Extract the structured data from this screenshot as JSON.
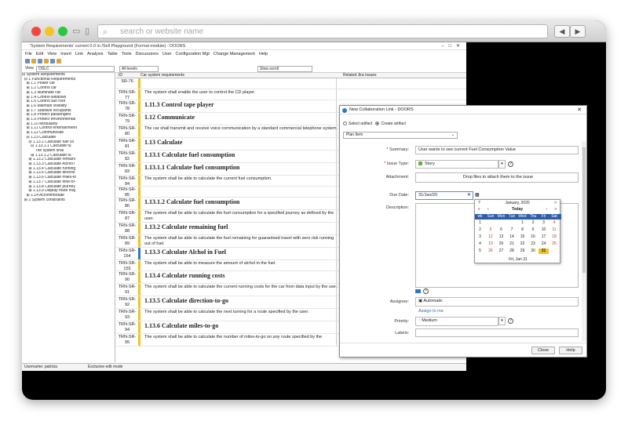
{
  "browser": {
    "address_placeholder": "search or website name",
    "back": "◀",
    "forward": "▶"
  },
  "doors": {
    "title": "'System Requirements' current 0.0 in /Sell Playground (Formal module) - DOORS",
    "menu": [
      "File",
      "Edit",
      "View",
      "Insert",
      "Link",
      "Analysis",
      "Table",
      "Tools",
      "Discussions",
      "User",
      "Configuration Mgt",
      "Change Management",
      "Help"
    ],
    "view_label": "View",
    "view_value": "OSLC",
    "levels_value": "All levels",
    "scroll_value": "Slow scroll",
    "tree": [
      "⊟ System Requirements",
      "  ⊟ 1 Functional Requirements",
      "    ⊞ 1.1 Power car",
      "    ⊞ 1.2 Control car",
      "    ⊞ 1.3 Illuminate car",
      "    ⊞ 1.4 Control windows",
      "    ⊞ 1.5 Control sun roof",
      "    ⊞ 1.6 Maintain visibility",
      "    ⊞ 1.7 Stabilize occupants",
      "    ⊞ 1.8 Protect passengers",
      "    ⊞ 1.9 Protect environmental",
      "    ⊞ 1.10 Modularity",
      "    ⊞ 1.11 Control entertainment",
      "    ⊞ 1.12 Communicate",
      "    ⊟ 1.13 Calculate",
      "      ⊟ 1.13.1 Calculate fuel co",
      "        ⊟ 1.13.1.1 Calculate fu",
      "            The system shal",
      "        ⊞ 1.13.1.2 Calculate fu",
      "      ⊞ 1.13.2 Calculate remaini",
      "      ⊞ 1.13.3 Calculate Alchol i",
      "      ⊞ 1.13.4 Calculate running",
      "      ⊞ 1.13.5 Calculate directio",
      "      ⊞ 1.13.6 Calculate miles-to",
      "      ⊞ 1.13.7 Calculate time-to-",
      "      ⊞ 1.13.8 Calculate journey",
      "      ⊞ 1.13.9 Display route maj",
      "    ⊞ 1.14 Accommodate",
      "  ⊞ 2 System constraints"
    ],
    "columns": {
      "id": "ID",
      "req": "Car system requirements",
      "jira": "Related Jira Issues"
    },
    "rows": [
      {
        "id": "SR-76",
        "kind": "b",
        "text": "",
        "blue": false
      },
      {
        "id": "TRN-SR-77",
        "kind": "b",
        "text": "The system shall enable the user to control the CD player.",
        "blue": false
      },
      {
        "id": "TRN-SR-78",
        "kind": "h",
        "text": "1.11.3 Control tape player",
        "blue": false
      },
      {
        "id": "TRN-SR-79",
        "kind": "h",
        "text": "1.12 Communicate",
        "blue": false
      },
      {
        "id": "TRN-SR-80",
        "kind": "b",
        "text": "The car shall transmit and receive voice communication by a standard commercial telephone system.",
        "blue": false
      },
      {
        "id": "TRN-SR-81",
        "kind": "h",
        "text": "1.13 Calculate",
        "blue": false
      },
      {
        "id": "TRN-SR-82",
        "kind": "h",
        "text": "1.13.1 Calculate fuel consumption",
        "blue": false
      },
      {
        "id": "TRN-SR-83",
        "kind": "h",
        "text": "1.13.1.1 Calculate fuel consumption",
        "blue": false
      },
      {
        "id": "TRN-SR-84",
        "kind": "b",
        "text": "The system shall be able to calculate the current fuel consumption.",
        "blue": false
      },
      {
        "id": "TRN-SR-85",
        "kind": "b",
        "text": "",
        "blue": false
      },
      {
        "id": "TRN-SR-86",
        "kind": "h",
        "text": "1.13.1.2 Calculate fuel consumption",
        "blue": false
      },
      {
        "id": "TRN-SR-87",
        "kind": "b",
        "text": "The system shall be able to calculate the fuel consumption for a specified  journey as defined by the user.",
        "blue": false
      },
      {
        "id": "TRN-SR-88",
        "kind": "h",
        "text": "1.13.2 Calculate remaining fuel",
        "blue": false
      },
      {
        "id": "TRN-SR-89",
        "kind": "b",
        "text": "The system shall be able to calculate the fuel remaining for guaranteed travel with zero risk running out of fuel.",
        "blue": false
      },
      {
        "id": "TRN-SR-154",
        "kind": "h",
        "text": "1.13.3 Calculate Alchol in Fuel",
        "blue": true
      },
      {
        "id": "TRN-SR-155",
        "kind": "b",
        "text": "The system shall be able to measure the amount of alchol in the fuel.",
        "blue": false
      },
      {
        "id": "TRN-SR-90",
        "kind": "h",
        "text": "1.13.4 Calculate running costs",
        "blue": false
      },
      {
        "id": "TRN-SR-91",
        "kind": "b",
        "text": "The system shall be able to calculate the current running costs for the car from data input by the user.",
        "blue": false
      },
      {
        "id": "TRN-SR-92",
        "kind": "h",
        "text": "1.13.5 Calculate direction-to-go",
        "blue": false
      },
      {
        "id": "TRN-SR-93",
        "kind": "b",
        "text": "The system shall be able to calculate the next turning for a route specified by the user.",
        "blue": false
      },
      {
        "id": "TRN-SR-94",
        "kind": "h",
        "text": "1.13.6 Calculate miles-to-go",
        "blue": false
      },
      {
        "id": "TRN-SR-95",
        "kind": "b",
        "text": "The system shall be able to calculate the number of miles-to-go on any route specified by the",
        "blue": false
      }
    ],
    "status_user": "Username: patricia",
    "status_mode": "Exclusive edit mode"
  },
  "dialog": {
    "title": "New Collaboration Link - DOORS",
    "close": "✕",
    "select_artifact": "Select artifact",
    "create_artifact": "Create artifact",
    "plan_item": "Plan Item",
    "summary_label": "Summary:",
    "summary_value": "User wants to see current Fuel Consumption Value",
    "issue_type_label": "Issue Type:",
    "issue_type_value": "Story",
    "attachment_label": "Attachment:",
    "attachment_hint": "Drop files to attach them to the issue",
    "due_date_label": "Due Date:",
    "due_date_value": "31/Jan/20",
    "description_label": "Description:",
    "calendar": {
      "month": "January, 2020",
      "today": "Today",
      "nav_prev_year": "«",
      "nav_prev": "‹",
      "nav_next": "›",
      "nav_next_year": "»",
      "nav_q": "?",
      "nav_x": "×",
      "days": [
        "wk",
        "Sun",
        "Mon",
        "Tue",
        "Wed",
        "Thu",
        "Fri",
        "Sat"
      ],
      "weeks": [
        [
          "1",
          "",
          "",
          "",
          "1",
          "2",
          "3",
          "4"
        ],
        [
          "2",
          "5",
          "6",
          "7",
          "8",
          "9",
          "10",
          "11"
        ],
        [
          "3",
          "12",
          "13",
          "14",
          "15",
          "16",
          "17",
          "18"
        ],
        [
          "4",
          "19",
          "20",
          "21",
          "22",
          "23",
          "24",
          "25"
        ],
        [
          "5",
          "26",
          "27",
          "28",
          "29",
          "30",
          "31",
          ""
        ]
      ],
      "footer": "Fri, Jan 31",
      "selected": "31"
    },
    "assignee_label": "Assignee:",
    "assignee_value": "Automatic",
    "assign_to_me": "Assign to me",
    "priority_label": "Priority:",
    "priority_value": "Medium",
    "labels_label": "Labels:",
    "close_button": "Close",
    "help_button": "Help"
  }
}
